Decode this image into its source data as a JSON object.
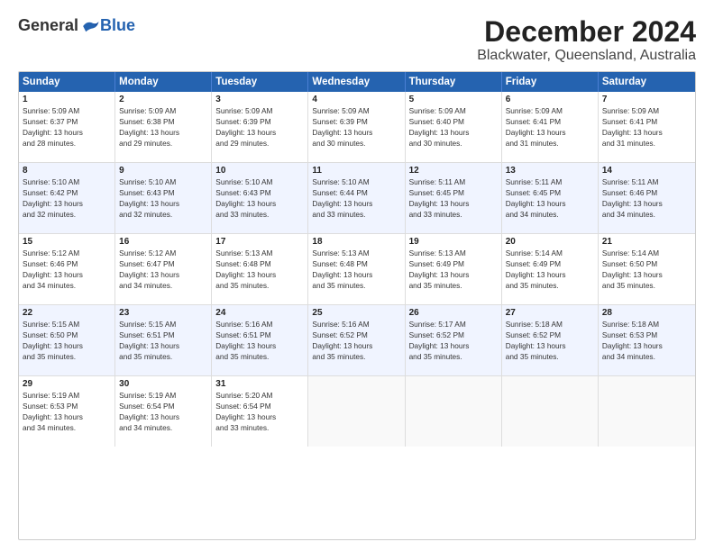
{
  "logo": {
    "general": "General",
    "blue": "Blue"
  },
  "title": "December 2024",
  "subtitle": "Blackwater, Queensland, Australia",
  "days": [
    "Sunday",
    "Monday",
    "Tuesday",
    "Wednesday",
    "Thursday",
    "Friday",
    "Saturday"
  ],
  "weeks": [
    {
      "alt": false,
      "cells": [
        {
          "day": "1",
          "info": "Sunrise: 5:09 AM\nSunset: 6:37 PM\nDaylight: 13 hours\nand 28 minutes."
        },
        {
          "day": "2",
          "info": "Sunrise: 5:09 AM\nSunset: 6:38 PM\nDaylight: 13 hours\nand 29 minutes."
        },
        {
          "day": "3",
          "info": "Sunrise: 5:09 AM\nSunset: 6:39 PM\nDaylight: 13 hours\nand 29 minutes."
        },
        {
          "day": "4",
          "info": "Sunrise: 5:09 AM\nSunset: 6:39 PM\nDaylight: 13 hours\nand 30 minutes."
        },
        {
          "day": "5",
          "info": "Sunrise: 5:09 AM\nSunset: 6:40 PM\nDaylight: 13 hours\nand 30 minutes."
        },
        {
          "day": "6",
          "info": "Sunrise: 5:09 AM\nSunset: 6:41 PM\nDaylight: 13 hours\nand 31 minutes."
        },
        {
          "day": "7",
          "info": "Sunrise: 5:09 AM\nSunset: 6:41 PM\nDaylight: 13 hours\nand 31 minutes."
        }
      ]
    },
    {
      "alt": true,
      "cells": [
        {
          "day": "8",
          "info": "Sunrise: 5:10 AM\nSunset: 6:42 PM\nDaylight: 13 hours\nand 32 minutes."
        },
        {
          "day": "9",
          "info": "Sunrise: 5:10 AM\nSunset: 6:43 PM\nDaylight: 13 hours\nand 32 minutes."
        },
        {
          "day": "10",
          "info": "Sunrise: 5:10 AM\nSunset: 6:43 PM\nDaylight: 13 hours\nand 33 minutes."
        },
        {
          "day": "11",
          "info": "Sunrise: 5:10 AM\nSunset: 6:44 PM\nDaylight: 13 hours\nand 33 minutes."
        },
        {
          "day": "12",
          "info": "Sunrise: 5:11 AM\nSunset: 6:45 PM\nDaylight: 13 hours\nand 33 minutes."
        },
        {
          "day": "13",
          "info": "Sunrise: 5:11 AM\nSunset: 6:45 PM\nDaylight: 13 hours\nand 34 minutes."
        },
        {
          "day": "14",
          "info": "Sunrise: 5:11 AM\nSunset: 6:46 PM\nDaylight: 13 hours\nand 34 minutes."
        }
      ]
    },
    {
      "alt": false,
      "cells": [
        {
          "day": "15",
          "info": "Sunrise: 5:12 AM\nSunset: 6:46 PM\nDaylight: 13 hours\nand 34 minutes."
        },
        {
          "day": "16",
          "info": "Sunrise: 5:12 AM\nSunset: 6:47 PM\nDaylight: 13 hours\nand 34 minutes."
        },
        {
          "day": "17",
          "info": "Sunrise: 5:13 AM\nSunset: 6:48 PM\nDaylight: 13 hours\nand 35 minutes."
        },
        {
          "day": "18",
          "info": "Sunrise: 5:13 AM\nSunset: 6:48 PM\nDaylight: 13 hours\nand 35 minutes."
        },
        {
          "day": "19",
          "info": "Sunrise: 5:13 AM\nSunset: 6:49 PM\nDaylight: 13 hours\nand 35 minutes."
        },
        {
          "day": "20",
          "info": "Sunrise: 5:14 AM\nSunset: 6:49 PM\nDaylight: 13 hours\nand 35 minutes."
        },
        {
          "day": "21",
          "info": "Sunrise: 5:14 AM\nSunset: 6:50 PM\nDaylight: 13 hours\nand 35 minutes."
        }
      ]
    },
    {
      "alt": true,
      "cells": [
        {
          "day": "22",
          "info": "Sunrise: 5:15 AM\nSunset: 6:50 PM\nDaylight: 13 hours\nand 35 minutes."
        },
        {
          "day": "23",
          "info": "Sunrise: 5:15 AM\nSunset: 6:51 PM\nDaylight: 13 hours\nand 35 minutes."
        },
        {
          "day": "24",
          "info": "Sunrise: 5:16 AM\nSunset: 6:51 PM\nDaylight: 13 hours\nand 35 minutes."
        },
        {
          "day": "25",
          "info": "Sunrise: 5:16 AM\nSunset: 6:52 PM\nDaylight: 13 hours\nand 35 minutes."
        },
        {
          "day": "26",
          "info": "Sunrise: 5:17 AM\nSunset: 6:52 PM\nDaylight: 13 hours\nand 35 minutes."
        },
        {
          "day": "27",
          "info": "Sunrise: 5:18 AM\nSunset: 6:52 PM\nDaylight: 13 hours\nand 35 minutes."
        },
        {
          "day": "28",
          "info": "Sunrise: 5:18 AM\nSunset: 6:53 PM\nDaylight: 13 hours\nand 34 minutes."
        }
      ]
    },
    {
      "alt": false,
      "cells": [
        {
          "day": "29",
          "info": "Sunrise: 5:19 AM\nSunset: 6:53 PM\nDaylight: 13 hours\nand 34 minutes."
        },
        {
          "day": "30",
          "info": "Sunrise: 5:19 AM\nSunset: 6:54 PM\nDaylight: 13 hours\nand 34 minutes."
        },
        {
          "day": "31",
          "info": "Sunrise: 5:20 AM\nSunset: 6:54 PM\nDaylight: 13 hours\nand 33 minutes."
        },
        {
          "day": "",
          "info": ""
        },
        {
          "day": "",
          "info": ""
        },
        {
          "day": "",
          "info": ""
        },
        {
          "day": "",
          "info": ""
        }
      ]
    }
  ]
}
